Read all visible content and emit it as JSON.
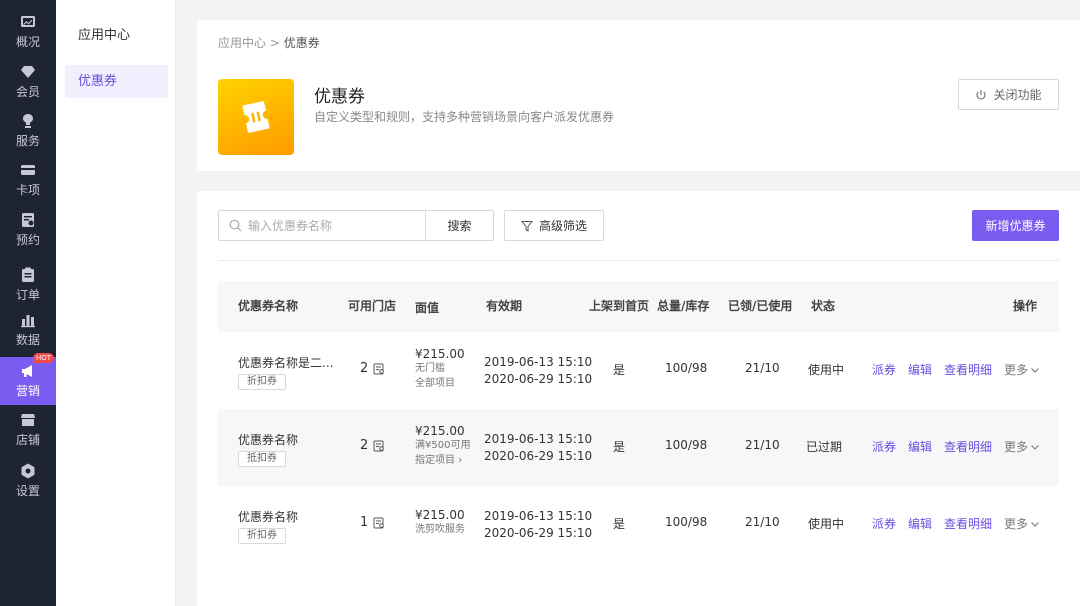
{
  "nav": {
    "items": [
      {
        "label": "概况",
        "icon": "overview-icon"
      },
      {
        "label": "会员",
        "icon": "member-icon"
      },
      {
        "label": "服务",
        "icon": "service-icon"
      },
      {
        "label": "卡项",
        "icon": "card-icon"
      },
      {
        "label": "预约",
        "icon": "appointment-icon"
      },
      {
        "label": "订单",
        "icon": "order-icon"
      },
      {
        "label": "数据",
        "icon": "data-icon"
      },
      {
        "label": "营销",
        "icon": "marketing-icon",
        "badge": "HOT",
        "active": true
      },
      {
        "label": "店铺",
        "icon": "store-icon"
      },
      {
        "label": "设置",
        "icon": "settings-icon"
      }
    ]
  },
  "submenu": {
    "title": "应用中心",
    "active_item": "优惠券"
  },
  "header": {
    "breadcrumb_root": "应用中心",
    "breadcrumb_sep": ">",
    "breadcrumb_current": "优惠券",
    "title": "优惠券",
    "description": "自定义类型和规则，支持多种营销场景向客户派发优惠券",
    "close_label": "关闭功能"
  },
  "toolbar": {
    "search_placeholder": "输入优惠券名称",
    "search_label": "搜索",
    "filter_label": "高级筛选",
    "add_label": "新增优惠券"
  },
  "table": {
    "columns": [
      "优惠券名称",
      "可用门店",
      "面值",
      "有效期",
      "上架到首页",
      "总量/库存",
      "已领/已使用",
      "状态",
      "操作"
    ],
    "rows": [
      {
        "name": "优惠券名称是二...",
        "tag": "折扣券",
        "stores": "2",
        "amount": "¥215.00",
        "sub1": "无门槛",
        "sub2": "全部项目",
        "start": "2019-06-13 15:10",
        "end": "2020-06-29 15:10",
        "shelf": "是",
        "qty": "100/98",
        "used": "21/10",
        "status": "使用中",
        "ops": [
          "派券",
          "编辑",
          "查看明细"
        ],
        "more": "更多"
      },
      {
        "name": "优惠券名称",
        "tag": "抵扣券",
        "stores": "2",
        "amount": "¥215.00",
        "sub1": "满¥500可用",
        "sub2": "指定项目",
        "start": "2019-06-13 15:10",
        "end": "2020-06-29 15:10",
        "shelf": "是",
        "qty": "100/98",
        "used": "21/10",
        "status": "已过期",
        "ops": [
          "派券",
          "编辑",
          "查看明细"
        ],
        "more": "更多"
      },
      {
        "name": "优惠券名称",
        "tag": "折扣券",
        "stores": "1",
        "amount": "¥215.00",
        "sub1": "洗剪吹服务",
        "sub2": "",
        "start": "2019-06-13 15:10",
        "end": "2020-06-29 15:10",
        "shelf": "是",
        "qty": "100/98",
        "used": "21/10",
        "status": "使用中",
        "ops": [
          "派券",
          "编辑",
          "查看明细"
        ],
        "more": "更多"
      }
    ]
  },
  "colors": {
    "accent": "#7a5cf0",
    "nav_bg": "#1e2431",
    "hot_badge": "#f04b4b",
    "logo_yellow": "#ffc400"
  }
}
